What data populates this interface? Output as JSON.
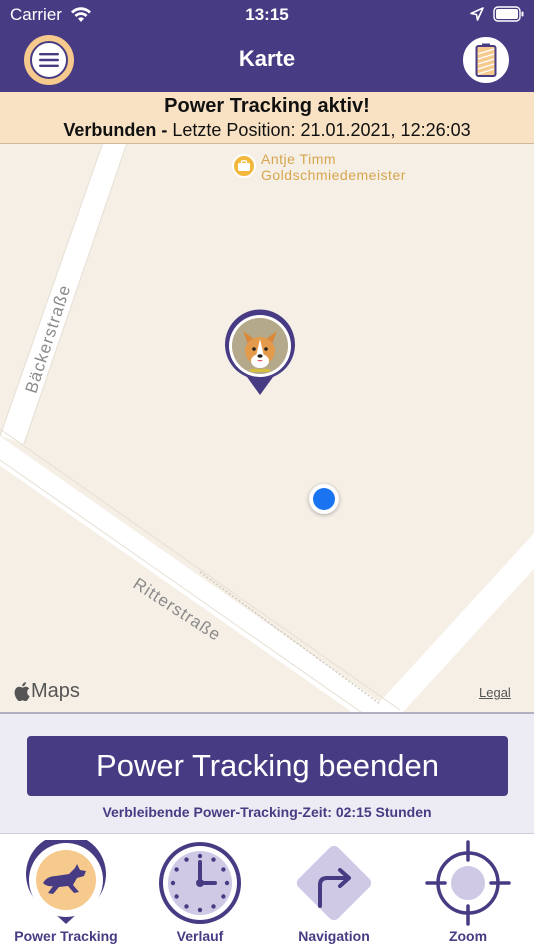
{
  "status_bar": {
    "carrier": "Carrier",
    "time": "13:15"
  },
  "nav": {
    "title": "Karte"
  },
  "banner": {
    "title": "Power Tracking aktiv!",
    "status": "Verbunden -",
    "last_position": "Letzte Position: 21.01.2021, 12:26:03"
  },
  "map": {
    "poi": {
      "name": "Antje Timm",
      "category": "Goldschmiedemeister"
    },
    "streets": [
      "Bäckerstraße",
      "Ritterstraße"
    ],
    "maps_label": "Maps",
    "legal": "Legal"
  },
  "power_tracking": {
    "button": "Power Tracking beenden",
    "remaining": "Verbleibende Power-Tracking-Zeit: 02:15 Stunden"
  },
  "tabs": [
    {
      "label": "Power Tracking",
      "icon": "running-dog-icon"
    },
    {
      "label": "Verlauf",
      "icon": "clock-icon"
    },
    {
      "label": "Navigation",
      "icon": "turn-right-arrow-icon"
    },
    {
      "label": "Zoom",
      "icon": "crosshair-icon"
    }
  ],
  "colors": {
    "primary": "#473c83",
    "accent": "#f6c98d",
    "banner_bg": "#f9e2c3",
    "map_bg": "#f5efe6",
    "user_location": "#1a73f1",
    "poi": "#f1b83c"
  }
}
